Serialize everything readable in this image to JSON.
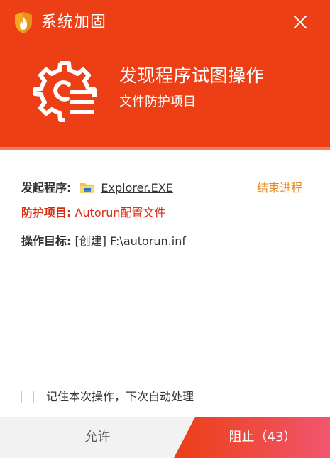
{
  "window": {
    "title": "系统加固",
    "close_icon": "close-icon"
  },
  "hero": {
    "title": "发现程序试图操作",
    "subtitle": "文件防护项目",
    "icon": "gear-list-icon"
  },
  "details": {
    "initiator_label": "发起程序:",
    "initiator_value": "Explorer.EXE",
    "initiator_icon": "folder-icon",
    "end_process_label": "结束进程",
    "protection_label": "防护项目:",
    "protection_value": "Autorun配置文件",
    "target_label": "操作目标:",
    "target_value": "[创建] F:\\autorun.inf"
  },
  "remember": {
    "label": "记住本次操作，下次自动处理",
    "checked": false
  },
  "buttons": {
    "allow_label": "允许",
    "block_label": "阻止（43）"
  },
  "colors": {
    "header_red": "#ec3f15",
    "stripe": "#f47a5c",
    "alert_red": "#d92b10",
    "link_orange": "#e88a1c",
    "footer_gray": "#f2f2f2"
  }
}
